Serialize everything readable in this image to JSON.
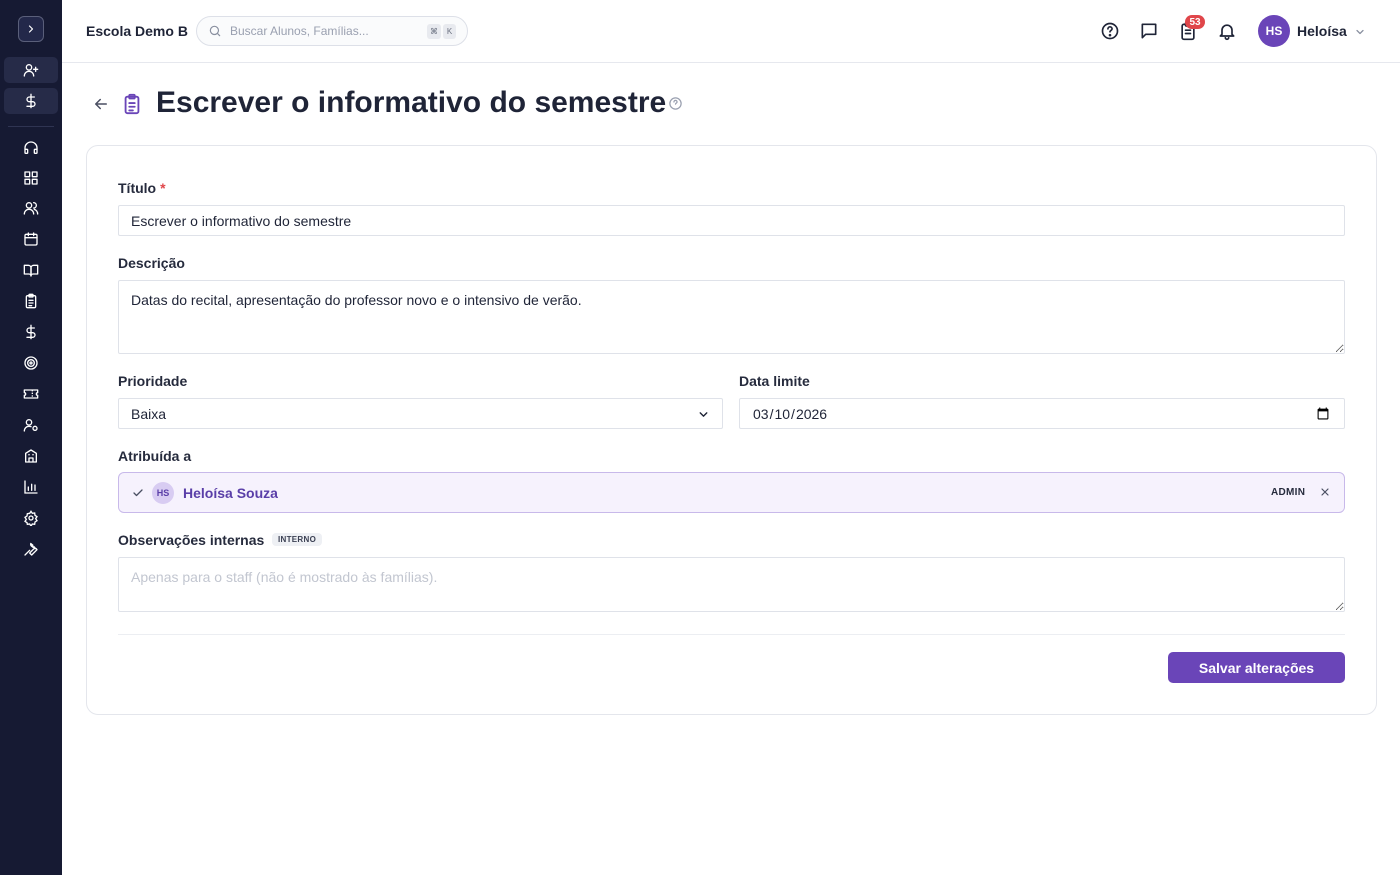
{
  "header": {
    "school_name": "Escola Demo B",
    "search_placeholder": "Buscar Alunos, Famílias...",
    "shortcut_mod": "⌘",
    "shortcut_key": "K",
    "tasks_badge": "53",
    "user_initials": "HS",
    "user_name": "Heloísa"
  },
  "sidebar": {
    "icons": [
      "chevron-right-icon",
      "user-plus-icon",
      "dollar-icon",
      "headset-icon",
      "dashboard-icon",
      "users-icon",
      "calendar-icon",
      "book-icon",
      "clipboard-icon",
      "dollar-icon",
      "target-icon",
      "ticket-icon",
      "user-settings-icon",
      "building-icon",
      "bar-chart-icon",
      "gear-icon",
      "wrench-icon"
    ]
  },
  "page": {
    "title": "Escrever o informativo do semestre"
  },
  "form": {
    "title_label": "Título",
    "title_required_mark": "*",
    "title_value": "Escrever o informativo do semestre",
    "description_label": "Descrição",
    "description_value": "Datas do recital, apresentação do professor novo e o intensivo de verão.",
    "priority_label": "Prioridade",
    "priority_value": "Baixa",
    "due_label": "Data limite",
    "due_value": "2026-03-10",
    "assigned_label": "Atribuída a",
    "assignee_initials": "HS",
    "assignee_name": "Heloísa Souza",
    "assignee_role": "ADMIN",
    "notes_label": "Observações internas",
    "notes_chip": "INTERNO",
    "notes_placeholder": "Apenas para o staff (não é mostrado às famílias).",
    "save_label": "Salvar alterações"
  },
  "colors": {
    "sidebar_bg": "#161a33",
    "accent": "#6a45b8",
    "badge": "#e0464a"
  }
}
